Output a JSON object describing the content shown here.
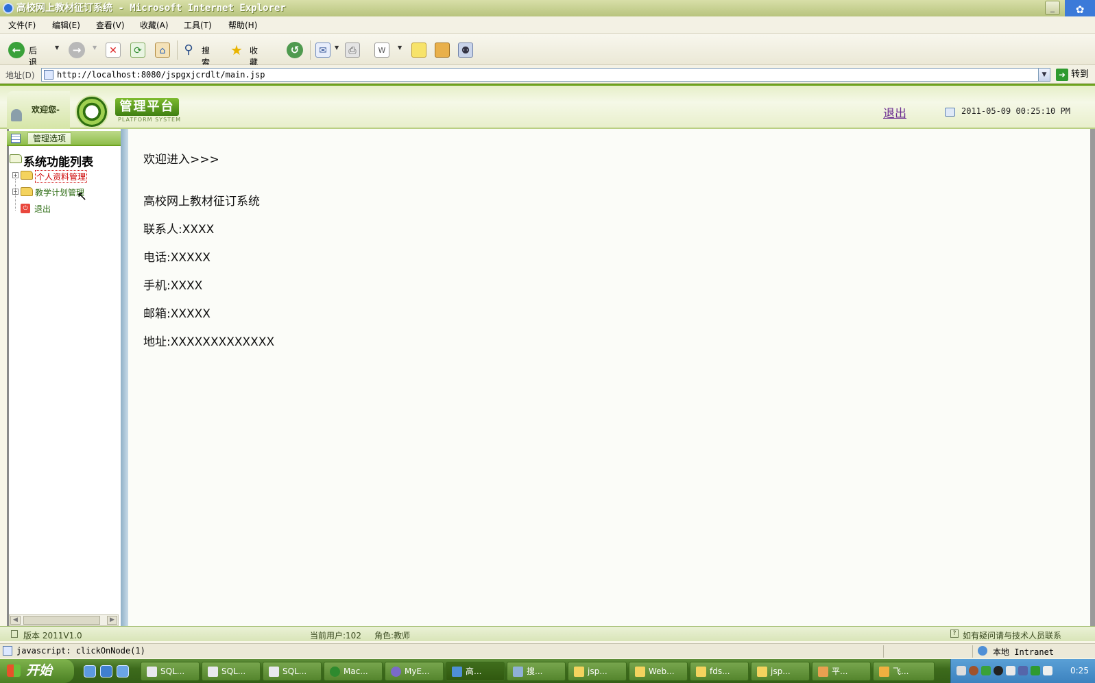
{
  "window": {
    "title": "高校网上教材征订系统 - Microsoft Internet Explorer",
    "min": "_"
  },
  "menu": [
    "文件(F)",
    "编辑(E)",
    "查看(V)",
    "收藏(A)",
    "工具(T)",
    "帮助(H)"
  ],
  "toolbar": {
    "back": "后退",
    "search": "搜索",
    "favorites": "收藏夹"
  },
  "address": {
    "label": "地址(D)",
    "url": "http://localhost:8080/jspgxjcrdlt/main.jsp",
    "go": "转到"
  },
  "header": {
    "welcome": "欢迎您-",
    "brand": "管理平台",
    "brand_sub": "PLATFORM SYSTEM",
    "logout": "退出",
    "datetime": "2011-05-09 00:25:10 PM"
  },
  "sidebar": {
    "tab": "管理选项",
    "root": "系统功能列表",
    "items": [
      {
        "label": "个人资料管理",
        "icon": "folder-icon"
      },
      {
        "label": "教学计划管理",
        "icon": "folder-icon"
      },
      {
        "label": "退出",
        "icon": "logout-icon"
      }
    ]
  },
  "content": {
    "breadcrumb": "欢迎进入>>>",
    "lines": [
      "高校网上教材征订系统",
      "联系人:XXXX",
      "电话:XXXXX",
      "手机:XXXX",
      "邮箱:XXXXX",
      "地址:XXXXXXXXXXXXX"
    ]
  },
  "footer": {
    "version": "版本 2011V1.0",
    "user": "当前用户:102",
    "role": "角色:教师",
    "help": "如有疑问请与技术人员联系"
  },
  "ie_status": {
    "text": "javascript: clickOnNode(1)",
    "zone": "本地 Intranet"
  },
  "taskbar": {
    "start": "开始",
    "tasks": [
      "SQL...",
      "SQL...",
      "SQL...",
      "Mac...",
      "MyE...",
      "高...",
      "搜...",
      "jsp...",
      "Web...",
      "fds...",
      "jsp...",
      "平...",
      "飞..."
    ],
    "clock": "0:25"
  }
}
